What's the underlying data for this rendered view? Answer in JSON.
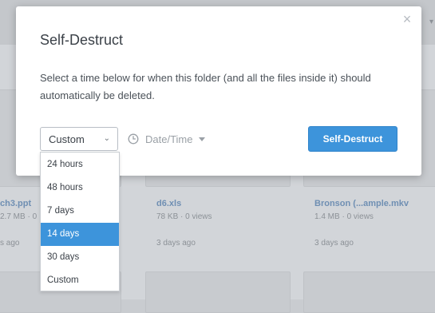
{
  "background": {
    "cards": [
      {
        "name": "ch3.ppt",
        "meta": "2.7 MB · 0",
        "date": "s ago"
      },
      {
        "name": "d6.xls",
        "meta": "78 KB · 0 views",
        "date": "3 days ago"
      },
      {
        "name": "Bronson (...ample.mkv",
        "meta": "1.4 MB · 0 views",
        "date": "3 days ago"
      }
    ]
  },
  "modal": {
    "title": "Self-Destruct",
    "description": "Select a time below for when this folder (and all the files inside it) should automatically be deleted.",
    "select": {
      "value": "Custom"
    },
    "datetime": {
      "label": "Date/Time"
    },
    "submit_label": "Self-Destruct",
    "close_label": "×"
  },
  "dropdown": {
    "options": [
      "24 hours",
      "48 hours",
      "7 days",
      "14 days",
      "30 days",
      "Custom"
    ],
    "highlighted": "14 days"
  },
  "colors": {
    "accent": "#3d94db",
    "overlay": "#d2d5d9"
  },
  "icons": {
    "close": "close-icon",
    "chevron": "chevron-down-icon",
    "clock": "clock-icon",
    "caret": "caret-down-icon"
  }
}
